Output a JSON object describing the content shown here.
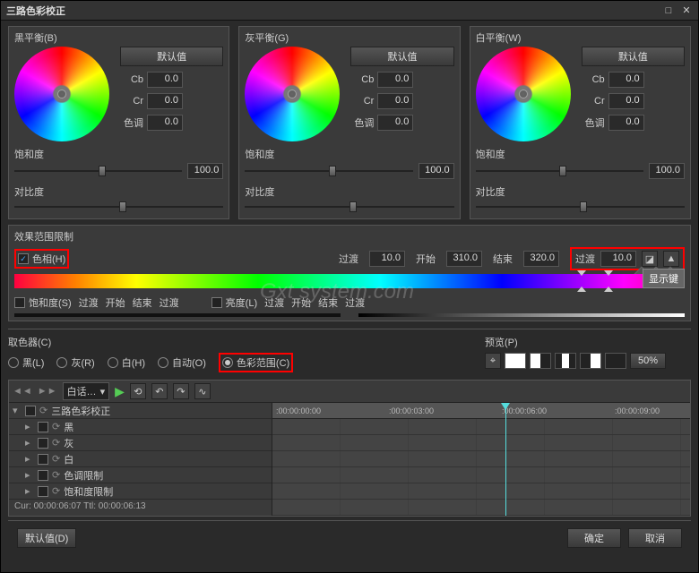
{
  "title": "三路色彩校正",
  "panels": {
    "black": {
      "label": "黑平衡(B)",
      "cb": "0.0",
      "cr": "0.0",
      "hue_label": "色调",
      "hue": "0.0"
    },
    "gray": {
      "label": "灰平衡(G)",
      "cb": "0.0",
      "cr": "0.0",
      "hue_label": "色调",
      "hue": "0.0"
    },
    "white": {
      "label": "白平衡(W)",
      "cb": "0.0",
      "cr": "0.0",
      "hue_label": "色调",
      "hue": "0.0"
    }
  },
  "default_btn": "默认值",
  "cb_label": "Cb",
  "cr_label": "Cr",
  "sat_label": "饱和度",
  "sat_value": "100.0",
  "contrast_label": "对比度",
  "limit": {
    "title": "效果范围限制",
    "hue_check": "色相(H)",
    "transition": "过渡",
    "transition_val": "10.0",
    "start": "开始",
    "start_val": "310.0",
    "end": "结束",
    "end_val": "320.0",
    "transition2": "过渡",
    "transition2_val": "10.0",
    "show_key": "显示键",
    "sat_check": "饱和度(S)",
    "bright_check": "亮度(L)"
  },
  "picker": {
    "title": "取色器(C)",
    "black": "黑(L)",
    "gray": "灰(R)",
    "white": "白(H)",
    "auto": "自动(O)",
    "range": "色彩范围(C)"
  },
  "preview": {
    "title": "预览(P)",
    "percent": "50%"
  },
  "timeline": {
    "dropdown": "白话…",
    "root": "三路色彩校正",
    "items": [
      "黑",
      "灰",
      "白",
      "色调限制",
      "饱和度限制"
    ],
    "ruler": [
      ":00:00:00:00",
      ":00:00:03:00",
      ":00:00:06:00",
      ":00:00:09:00"
    ],
    "status": "Cur: 00:00:06:07  Ttl: 00:00:06:13"
  },
  "footer": {
    "default": "默认值(D)",
    "ok": "确定",
    "cancel": "取消"
  },
  "watermark": "Gxt system.com",
  "chart_data": {
    "type": "table",
    "title": "三路色彩校正 parameters",
    "series": [
      {
        "name": "黑平衡",
        "values": {
          "Cb": 0.0,
          "Cr": 0.0,
          "色调": 0.0,
          "饱和度": 100.0
        }
      },
      {
        "name": "灰平衡",
        "values": {
          "Cb": 0.0,
          "Cr": 0.0,
          "色调": 0.0,
          "饱和度": 100.0
        }
      },
      {
        "name": "白平衡",
        "values": {
          "Cb": 0.0,
          "Cr": 0.0,
          "色调": 0.0,
          "饱和度": 100.0
        }
      }
    ],
    "hue_limit": {
      "过渡1": 10.0,
      "开始": 310.0,
      "结束": 320.0,
      "过渡2": 10.0
    }
  }
}
